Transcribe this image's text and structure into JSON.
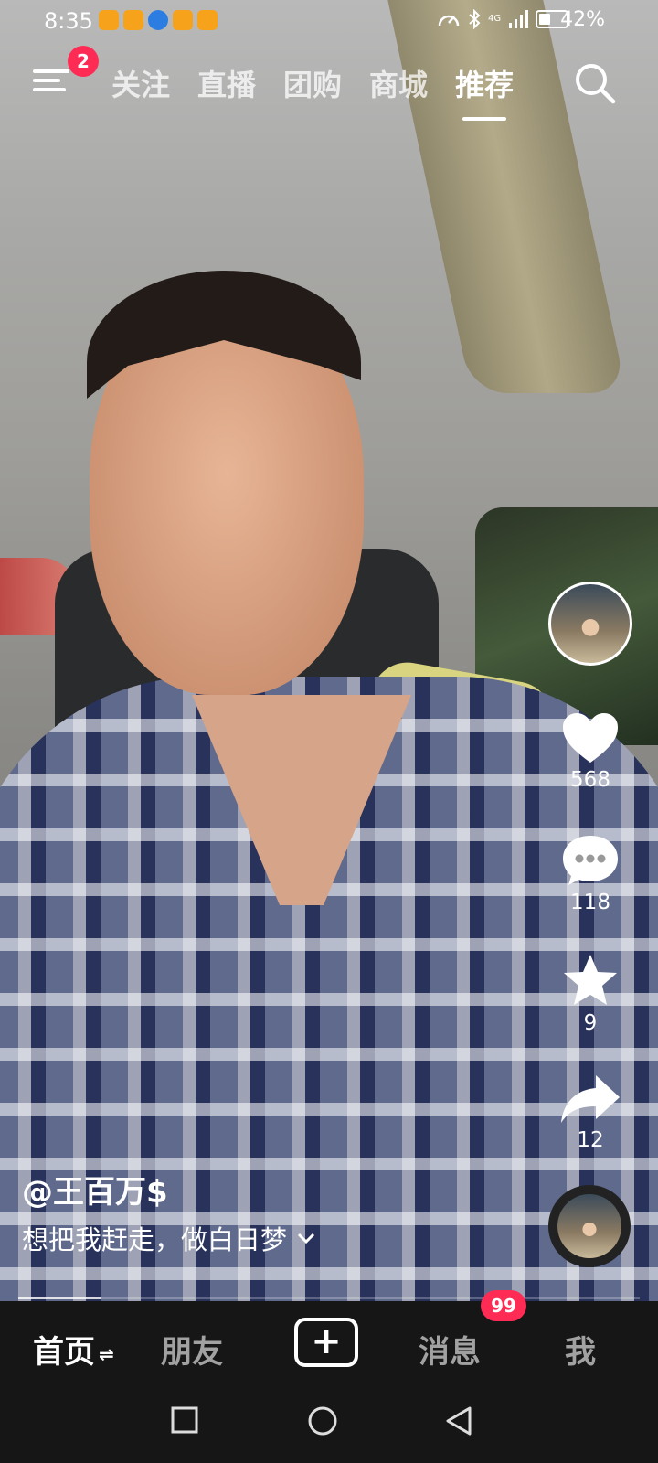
{
  "status_bar": {
    "time": "8:35",
    "battery": "42%",
    "network": "4G"
  },
  "top_nav": {
    "menu_badge": "2",
    "tabs": [
      "关注",
      "直播",
      "团购",
      "商城",
      "推荐"
    ],
    "active_tab": "推荐"
  },
  "actions": {
    "likes": "568",
    "comments": "118",
    "favorites": "9",
    "shares": "12"
  },
  "video": {
    "author": "@王百万$",
    "description": "想把我赶走，做白日梦"
  },
  "bottom_nav": {
    "home": "首页",
    "friends": "朋友",
    "create": "+",
    "messages": "消息",
    "messages_badge": "99",
    "me": "我"
  },
  "colors": {
    "accent": "#fe2c55",
    "bar_bg": "#161616"
  }
}
